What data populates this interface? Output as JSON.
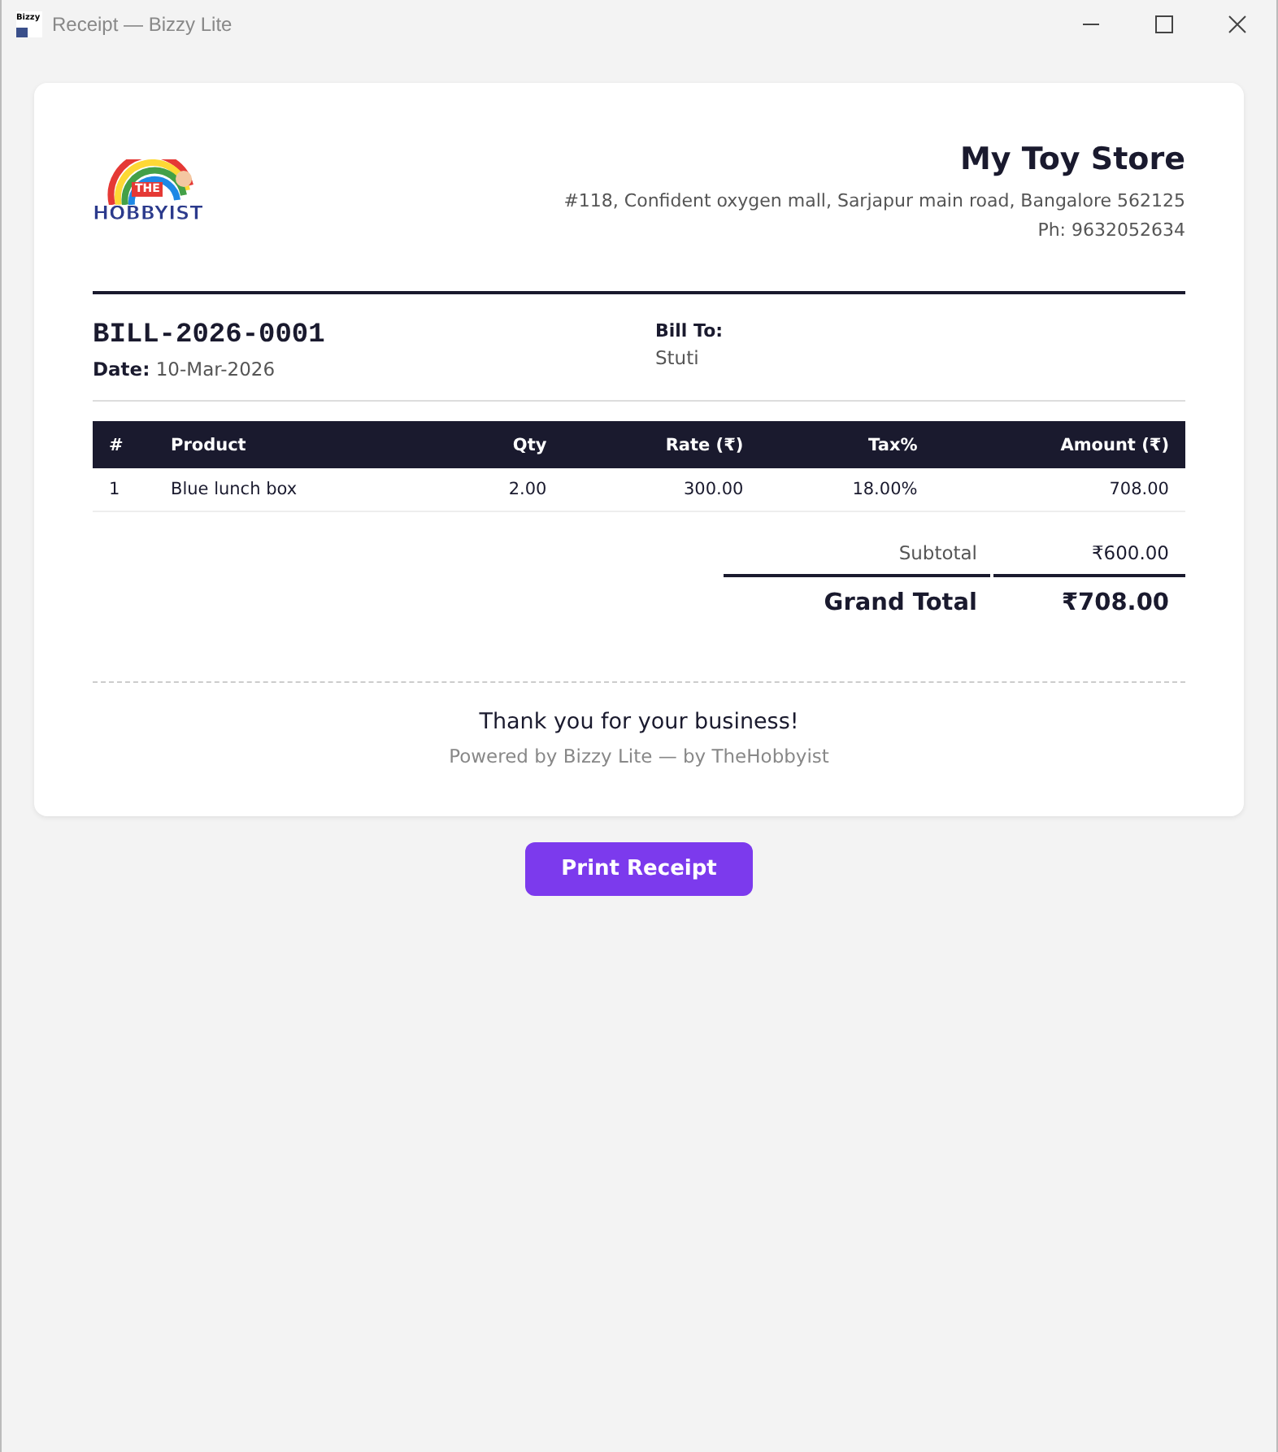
{
  "window": {
    "title": "Receipt — Bizzy Lite",
    "app_icon_text": "Bizzy"
  },
  "logo": {
    "top": "THE",
    "bottom": "HOBBYIST"
  },
  "store": {
    "name": "My Toy Store",
    "address": "#118, Confident oxygen mall, Sarjapur main road, Bangalore 562125",
    "phone": "Ph: 9632052634"
  },
  "bill": {
    "number": "BILL-2026-0001",
    "date_label": "Date:",
    "date": "10-Mar-2026",
    "bill_to_label": "Bill To:",
    "customer": "Stuti"
  },
  "table": {
    "columns": [
      "#",
      "Product",
      "Qty",
      "Rate (₹)",
      "Tax%",
      "Amount (₹)"
    ],
    "rows": [
      [
        "1",
        "Blue lunch box",
        "2.00",
        "300.00",
        "18.00%",
        "708.00"
      ]
    ]
  },
  "totals": [
    {
      "kind": "sub",
      "label": "Subtotal",
      "value": "₹600.00"
    },
    {
      "kind": "grand",
      "label": "Grand Total",
      "value": "₹708.00"
    }
  ],
  "footer": {
    "thanks": "Thank you for your business!",
    "powered": "Powered by Bizzy Lite — by TheHobbyist"
  },
  "buttons": [
    "Print Receipt"
  ]
}
